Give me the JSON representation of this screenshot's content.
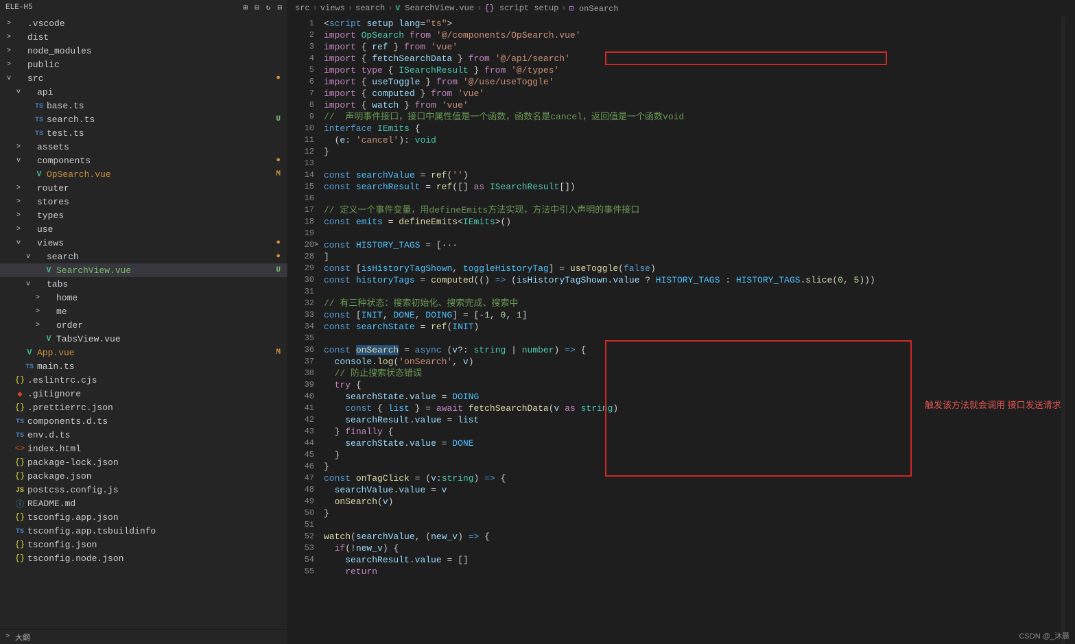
{
  "sidebar": {
    "project": "ELE-H5",
    "outline": "大纲",
    "tree": [
      {
        "d": 0,
        "chev": ">",
        "icon": "folder",
        "label": ".vscode"
      },
      {
        "d": 0,
        "chev": ">",
        "icon": "folder",
        "label": "dist"
      },
      {
        "d": 0,
        "chev": ">",
        "icon": "folder",
        "label": "node_modules"
      },
      {
        "d": 0,
        "chev": ">",
        "icon": "folder",
        "label": "public"
      },
      {
        "d": 0,
        "chev": "v",
        "icon": "folder",
        "label": "src",
        "dot": true
      },
      {
        "d": 1,
        "chev": "v",
        "icon": "folder",
        "label": "api"
      },
      {
        "d": 2,
        "icon": "ts",
        "label": "base.ts"
      },
      {
        "d": 2,
        "icon": "ts",
        "label": "search.ts",
        "badge": "U",
        "bclass": "badge-u"
      },
      {
        "d": 2,
        "icon": "ts",
        "label": "test.ts"
      },
      {
        "d": 1,
        "chev": ">",
        "icon": "folder",
        "label": "assets"
      },
      {
        "d": 1,
        "chev": "v",
        "icon": "folder",
        "label": "components",
        "dot": true
      },
      {
        "d": 2,
        "icon": "vue",
        "label": "OpSearch.vue",
        "badge": "M",
        "bclass": "badge-m",
        "color": "#cc8f3c"
      },
      {
        "d": 1,
        "chev": ">",
        "icon": "folder",
        "label": "router"
      },
      {
        "d": 1,
        "chev": ">",
        "icon": "folder",
        "label": "stores"
      },
      {
        "d": 1,
        "chev": ">",
        "icon": "folder",
        "label": "types"
      },
      {
        "d": 1,
        "chev": ">",
        "icon": "folder",
        "label": "use"
      },
      {
        "d": 1,
        "chev": "v",
        "icon": "folder",
        "label": "views",
        "dot": true
      },
      {
        "d": 2,
        "chev": "v",
        "icon": "folder",
        "label": "search",
        "dot": true
      },
      {
        "d": 3,
        "icon": "vue",
        "label": "SearchView.vue",
        "badge": "U",
        "bclass": "badge-u",
        "selected": true,
        "color": "#7dbd6f"
      },
      {
        "d": 2,
        "chev": "v",
        "icon": "folder",
        "label": "tabs"
      },
      {
        "d": 3,
        "chev": ">",
        "icon": "folder",
        "label": "home"
      },
      {
        "d": 3,
        "chev": ">",
        "icon": "folder",
        "label": "me"
      },
      {
        "d": 3,
        "chev": ">",
        "icon": "folder",
        "label": "order"
      },
      {
        "d": 3,
        "icon": "vue",
        "label": "TabsView.vue"
      },
      {
        "d": 1,
        "icon": "vue",
        "label": "App.vue",
        "badge": "M",
        "bclass": "badge-m",
        "color": "#cc8f3c"
      },
      {
        "d": 1,
        "icon": "ts",
        "label": "main.ts"
      },
      {
        "d": 0,
        "icon": "json",
        "label": ".eslintrc.cjs"
      },
      {
        "d": 0,
        "icon": "git",
        "label": ".gitignore"
      },
      {
        "d": 0,
        "icon": "json",
        "label": ".prettierrc.json"
      },
      {
        "d": 0,
        "icon": "ts",
        "label": "components.d.ts"
      },
      {
        "d": 0,
        "icon": "ts",
        "label": "env.d.ts"
      },
      {
        "d": 0,
        "icon": "html",
        "label": "index.html"
      },
      {
        "d": 0,
        "icon": "json",
        "label": "package-lock.json"
      },
      {
        "d": 0,
        "icon": "json",
        "label": "package.json"
      },
      {
        "d": 0,
        "icon": "js",
        "label": "postcss.config.js"
      },
      {
        "d": 0,
        "icon": "md",
        "label": "README.md"
      },
      {
        "d": 0,
        "icon": "json",
        "label": "tsconfig.app.json"
      },
      {
        "d": 0,
        "icon": "ts",
        "label": "tsconfig.app.tsbuildinfo"
      },
      {
        "d": 0,
        "icon": "json",
        "label": "tsconfig.json"
      },
      {
        "d": 0,
        "icon": "json",
        "label": "tsconfig.node.json"
      }
    ]
  },
  "breadcrumb": [
    "src",
    "views",
    "search",
    "SearchView.vue",
    "script setup",
    "onSearch"
  ],
  "annotation": "触发该方法就会调用 接口发送请求",
  "watermark": "CSDN @_沐晨",
  "code_lines": [
    {
      "n": 1,
      "html": "&lt;<span class='tk-type'>script</span> <span class='tk-var'>setup</span> <span class='tk-var'>lang</span>=<span class='tk-str'>\"ts\"</span>&gt;"
    },
    {
      "n": 2,
      "html": "<span class='tk-kw'>import</span> <span class='tk-cls'>OpSearch</span> <span class='tk-kw'>from</span> <span class='tk-str'>'@/components/OpSearch.vue'</span>"
    },
    {
      "n": 3,
      "html": "<span class='tk-kw'>import</span> { <span class='tk-var'>ref</span> } <span class='tk-kw'>from</span> <span class='tk-str'>'vue'</span>"
    },
    {
      "n": 4,
      "html": "<span class='tk-kw'>import</span> { <span class='tk-var'>fetchSearchData</span> } <span class='tk-kw'>from</span> <span class='tk-str'>'@/api/search'</span>"
    },
    {
      "n": 5,
      "html": "<span class='tk-kw'>import</span> <span class='tk-kw'>type</span> { <span class='tk-cls'>ISearchResult</span> } <span class='tk-kw'>from</span> <span class='tk-str'>'@/types'</span>"
    },
    {
      "n": 6,
      "html": "<span class='tk-kw'>import</span> { <span class='tk-var'>useToggle</span> } <span class='tk-kw'>from</span> <span class='tk-str'>'@/use/useToggle'</span>"
    },
    {
      "n": 7,
      "html": "<span class='tk-kw'>import</span> { <span class='tk-var'>computed</span> } <span class='tk-kw'>from</span> <span class='tk-str'>'vue'</span>"
    },
    {
      "n": 8,
      "html": "<span class='tk-kw'>import</span> { <span class='tk-var'>watch</span> } <span class='tk-kw'>from</span> <span class='tk-str'>'vue'</span>"
    },
    {
      "n": 9,
      "html": "<span class='tk-cm'>//  声明事件接口，接口中属性值是一个函数，函数名是cancel，返回值是一个函数void</span>"
    },
    {
      "n": 10,
      "html": "<span class='tk-type'>interface</span> <span class='tk-cls'>IEmits</span> {"
    },
    {
      "n": 11,
      "html": "  (<span class='tk-var'>e</span>: <span class='tk-str'>'cancel'</span>): <span class='tk-cls'>void</span>"
    },
    {
      "n": 12,
      "html": "}"
    },
    {
      "n": 13,
      "html": ""
    },
    {
      "n": 14,
      "html": "<span class='tk-type'>const</span> <span class='tk-const'>searchValue</span> = <span class='tk-fn'>ref</span>(<span class='tk-str'>''</span>)"
    },
    {
      "n": 15,
      "html": "<span class='tk-type'>const</span> <span class='tk-const'>searchResult</span> = <span class='tk-fn'>ref</span>([] <span class='tk-kw'>as</span> <span class='tk-cls'>ISearchResult</span>[])"
    },
    {
      "n": 16,
      "html": ""
    },
    {
      "n": 17,
      "html": "<span class='tk-cm'>// 定义一个事件变量，用defineEmits方法实现，方法中引入声明的事件接口</span>"
    },
    {
      "n": 18,
      "html": "<span class='tk-type'>const</span> <span class='tk-const'>emits</span> = <span class='tk-fn'>defineEmits</span>&lt;<span class='tk-cls'>IEmits</span>&gt;()"
    },
    {
      "n": 19,
      "html": ""
    },
    {
      "n": 20,
      "html": "<span class='fold-chev'>&gt;</span><span class='tk-type'>const</span> <span class='tk-const'>HISTORY_TAGS</span> = [<span class='tk-pn'>&middot;&middot;&middot;</span>"
    },
    {
      "n": 28,
      "html": "]"
    },
    {
      "n": 29,
      "html": "<span class='tk-type'>const</span> [<span class='tk-const'>isHistoryTagShown</span>, <span class='tk-const'>toggleHistoryTag</span>] = <span class='tk-fn'>useToggle</span>(<span class='tk-type'>false</span>)"
    },
    {
      "n": 30,
      "html": "<span class='tk-type'>const</span> <span class='tk-const'>historyTags</span> = <span class='tk-fn'>computed</span>(() <span class='tk-type'>=&gt;</span> (<span class='tk-var'>isHistoryTagShown</span>.<span class='tk-var'>value</span> ? <span class='tk-const'>HISTORY_TAGS</span> : <span class='tk-const'>HISTORY_TAGS</span>.<span class='tk-fn'>slice</span>(<span class='tk-num'>0</span>, <span class='tk-num'>5</span>)))"
    },
    {
      "n": 31,
      "html": ""
    },
    {
      "n": 32,
      "html": "<span class='tk-cm'>// 有三种状态：搜索初始化、搜索完成、搜索中</span>"
    },
    {
      "n": 33,
      "html": "<span class='tk-type'>const</span> [<span class='tk-const'>INIT</span>, <span class='tk-const'>DONE</span>, <span class='tk-const'>DOING</span>] = [<span class='tk-num'>-1</span>, <span class='tk-num'>0</span>, <span class='tk-num'>1</span>]"
    },
    {
      "n": 34,
      "html": "<span class='tk-type'>const</span> <span class='tk-const'>searchState</span> = <span class='tk-fn'>ref</span>(<span class='tk-const'>INIT</span>)"
    },
    {
      "n": 35,
      "html": ""
    },
    {
      "n": 36,
      "html": "<span class='tk-type'>const</span> <span class='tk-fn hlsel'>onSearch</span> = <span class='tk-type'>async</span> (<span class='tk-var'>v</span>?: <span class='tk-cls'>string</span> | <span class='tk-cls'>number</span>) <span class='tk-type'>=&gt;</span> {"
    },
    {
      "n": 37,
      "html": "  <span class='tk-var'>console</span>.<span class='tk-fn'>log</span>(<span class='tk-str'>'onSearch'</span>, <span class='tk-var'>v</span>)"
    },
    {
      "n": 38,
      "html": "  <span class='tk-cm'>// 防止搜索状态错误</span>"
    },
    {
      "n": 39,
      "html": "  <span class='tk-kw'>try</span> {"
    },
    {
      "n": 40,
      "html": "    <span class='tk-var'>searchState</span>.<span class='tk-var'>value</span> = <span class='tk-const'>DOING</span>"
    },
    {
      "n": 41,
      "html": "    <span class='tk-type'>const</span> { <span class='tk-const'>list</span> } = <span class='tk-kw'>await</span> <span class='tk-fn'>fetchSearchData</span>(<span class='tk-var'>v</span> <span class='tk-kw'>as</span> <span class='tk-cls'>string</span>)"
    },
    {
      "n": 42,
      "html": "    <span class='tk-var'>searchResult</span>.<span class='tk-var'>value</span> = <span class='tk-var'>list</span>"
    },
    {
      "n": 43,
      "html": "  } <span class='tk-kw'>finally</span> {"
    },
    {
      "n": 44,
      "html": "    <span class='tk-var'>searchState</span>.<span class='tk-var'>value</span> = <span class='tk-const'>DONE</span>"
    },
    {
      "n": 45,
      "html": "  }"
    },
    {
      "n": 46,
      "html": "}"
    },
    {
      "n": 47,
      "html": "<span class='tk-type'>const</span> <span class='tk-fn'>onTagClick</span> = (<span class='tk-var'>v</span>:<span class='tk-cls'>string</span>) <span class='tk-type'>=&gt;</span> {"
    },
    {
      "n": 48,
      "html": "  <span class='tk-var'>searchValue</span>.<span class='tk-var'>value</span> = <span class='tk-var'>v</span>"
    },
    {
      "n": 49,
      "html": "  <span class='tk-fn'>onSearch</span>(<span class='tk-var'>v</span>)"
    },
    {
      "n": 50,
      "html": "}"
    },
    {
      "n": 51,
      "html": ""
    },
    {
      "n": 52,
      "html": "<span class='tk-fn'>watch</span>(<span class='tk-var'>searchValue</span>, (<span class='tk-var'>new_v</span>) <span class='tk-type'>=&gt;</span> {"
    },
    {
      "n": 53,
      "html": "  <span class='tk-kw'>if</span>(!<span class='tk-var'>new_v</span>) {"
    },
    {
      "n": 54,
      "html": "    <span class='tk-var'>searchResult</span>.<span class='tk-var'>value</span> = []"
    },
    {
      "n": 55,
      "html": "    <span class='tk-kw'>return</span>"
    }
  ]
}
